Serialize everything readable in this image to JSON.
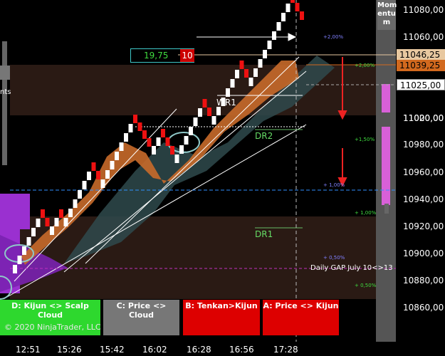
{
  "colors": {
    "background": "#000000",
    "zone_brown": "#2a1a14",
    "up_brick": "#ffffff",
    "down_brick": "#ee1111",
    "kijun_band": "#c86a2a",
    "cloud": "#2f4a4c",
    "volume_purple": "#9a30d0",
    "momentum_magenta": "#d860d8"
  },
  "momentum_label": [
    "Mom",
    "entu",
    "m"
  ],
  "y_axis_labels": [
    "11080,00",
    "11060,00",
    "11040,00",
    "11020,00",
    "11000,00",
    "10980,00",
    "10960,00",
    "10940,00",
    "10920,00",
    "10900,00",
    "10880,00",
    "10860,00"
  ],
  "x_axis_labels": [
    "12:51",
    "15:26",
    "15:42",
    "16:02",
    "16:28",
    "16:56",
    "17:28"
  ],
  "price_markers": {
    "current_tan": "11046,25",
    "current_orange": "11039,25",
    "level_white": "11025,00"
  },
  "counter": {
    "value": "19,75",
    "count": "10"
  },
  "zone_labels": {
    "wr1": "WR1",
    "dr2": "DR2",
    "dr1": "DR1"
  },
  "percent_labels": {
    "p200_blue": "+2,00%",
    "p200_green": "+2,00%",
    "p150_green": "+1,50%",
    "p100_blue": "+ 1,00%",
    "p100_green": "+ 1,00%",
    "p050_blue": "+ 0,50%",
    "p050_green": "+ 0,50%"
  },
  "gap_label": "Daily GAP July 10<>13",
  "left_cut_label": "nts",
  "buttons": {
    "kijun_scalp": "D: Kijun <> Scalp Cloud",
    "price_cloud": "C: Price <> Cloud",
    "tenkan_kijun": "B: Tenkan>Kijun",
    "price_kijun": "A: Price <> Kijun"
  },
  "copyright": "© 2020 NinjaTrader, LLC"
}
